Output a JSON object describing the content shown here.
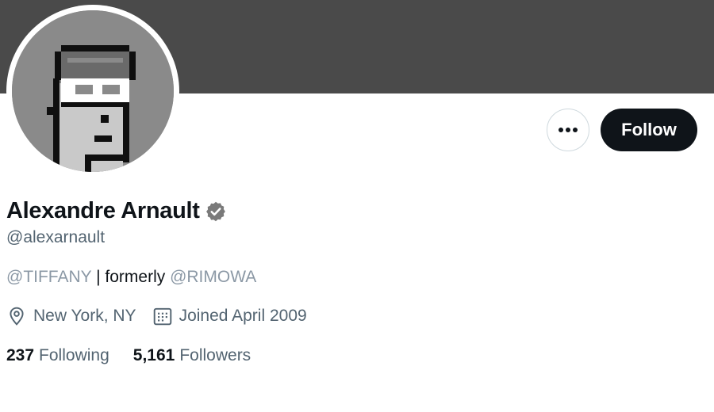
{
  "profile": {
    "name": "Alexandre Arnault",
    "handle": "@alexarnault",
    "bio": {
      "mention_1": "@TIFFANY",
      "separator": " | formerly ",
      "mention_2": "@RIMOWA"
    },
    "location": "New York, NY",
    "joined": "Joined April 2009",
    "following_count": "237",
    "following_label": "Following",
    "followers_count": "5,161",
    "followers_label": "Followers",
    "verified": true
  },
  "actions": {
    "follow_label": "Follow",
    "more_icon": "ellipsis-icon"
  },
  "colors": {
    "banner": "#4a4a4a",
    "follow_bg": "#0f1419",
    "mention": "#8b98a5",
    "secondary_text": "#536471"
  }
}
